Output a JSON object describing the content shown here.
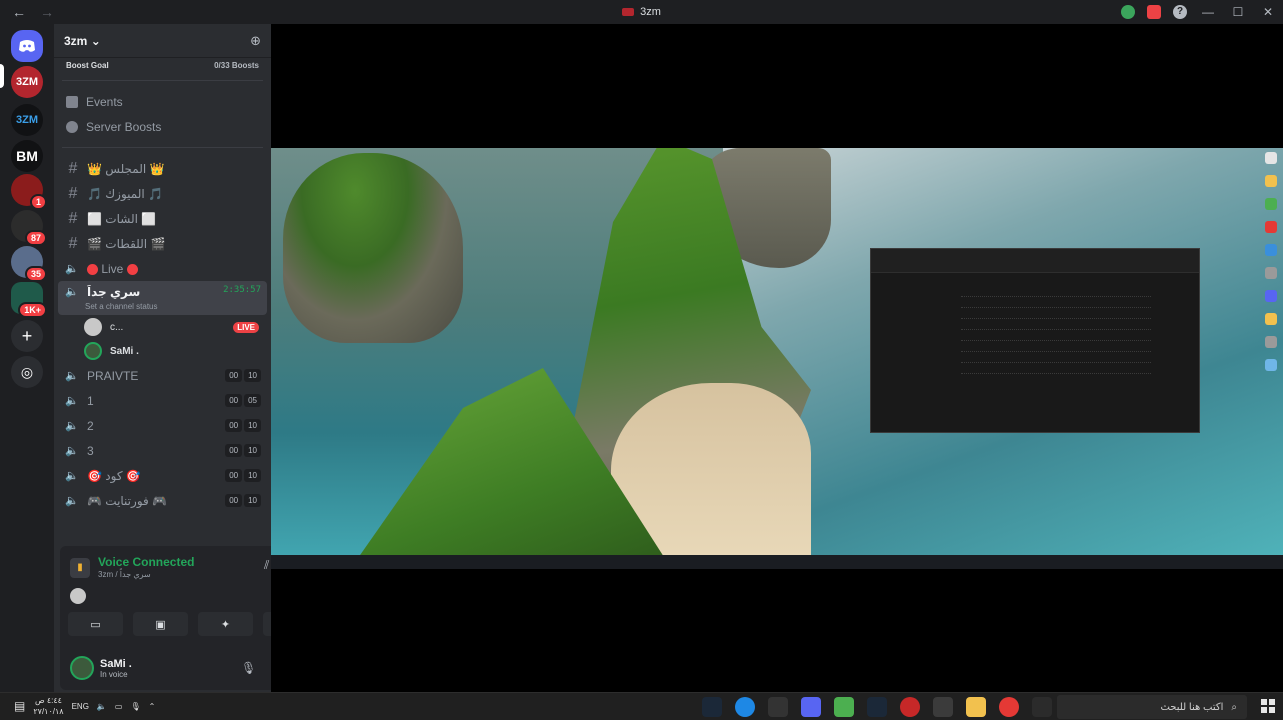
{
  "window": {
    "title": "3zm",
    "back_label": "←",
    "forward_label": "→",
    "help_label": "?",
    "minimize_label": "—",
    "maximize_label": "☐",
    "close_label": "✕"
  },
  "rail": {
    "home_icon": "discord-icon",
    "servers": [
      {
        "initials": "3ZM",
        "color": "#b3262e",
        "badge": ""
      },
      {
        "initials": "3ZM",
        "color": "#1e1f22",
        "badge": ""
      },
      {
        "initials": "BM",
        "color": "#111214",
        "badge": ""
      },
      {
        "initials": "",
        "color": "#8b1c1c",
        "badge": "1"
      },
      {
        "initials": "",
        "color": "#2c2c2c",
        "badge": "87"
      },
      {
        "initials": "",
        "color": "#5a6d8c",
        "badge": "35"
      },
      {
        "initials": "",
        "color": "#1f5a4a",
        "badge": "1K+"
      }
    ],
    "add_label": "+",
    "explore_label": "◎"
  },
  "server": {
    "name": "3zm",
    "chevron": "⌄",
    "boost_goal_label": "Boost Goal",
    "boost_goal_value": "0/33 Boosts"
  },
  "nav": {
    "events": "Events",
    "server_boosts": "Server Boosts"
  },
  "text_channels": [
    {
      "label": "👑 المجلس 👑"
    },
    {
      "label": "🎵 الميوزك 🎵"
    },
    {
      "label": "⬜ الشات ⬜"
    },
    {
      "label": "🎬 اللقطات 🎬"
    }
  ],
  "live_channel": {
    "label": "Live"
  },
  "active_channel": {
    "label": "سري جداً",
    "timer": "2:35:57",
    "status": "Set a channel status"
  },
  "members": [
    {
      "name": "c...",
      "live": "LIVE"
    },
    {
      "name": "SaMi ."
    }
  ],
  "voice_channels": [
    {
      "label": "PRAIVTE",
      "a": "00",
      "b": "10"
    },
    {
      "label": "1",
      "a": "00",
      "b": "05"
    },
    {
      "label": "2",
      "a": "00",
      "b": "10"
    },
    {
      "label": "3",
      "a": "00",
      "b": "10"
    },
    {
      "label": "🎯 كود 🎯",
      "a": "00",
      "b": "10"
    },
    {
      "label": "🎮 فورتنايت 🎮",
      "a": "00",
      "b": "10"
    }
  ],
  "voice_panel": {
    "title": "Voice Connected",
    "subtitle": "3zm / سري جداً",
    "buttons": [
      "▭",
      "▣",
      "✦",
      "✎"
    ]
  },
  "user": {
    "name": "SaMi .",
    "status": "In voice"
  },
  "taskbar": {
    "search_placeholder": "اكتب هنا للبحث",
    "lang": "ENG",
    "time": "٤:٤٤ ص",
    "date": "٢٧/١٠/١٨"
  }
}
